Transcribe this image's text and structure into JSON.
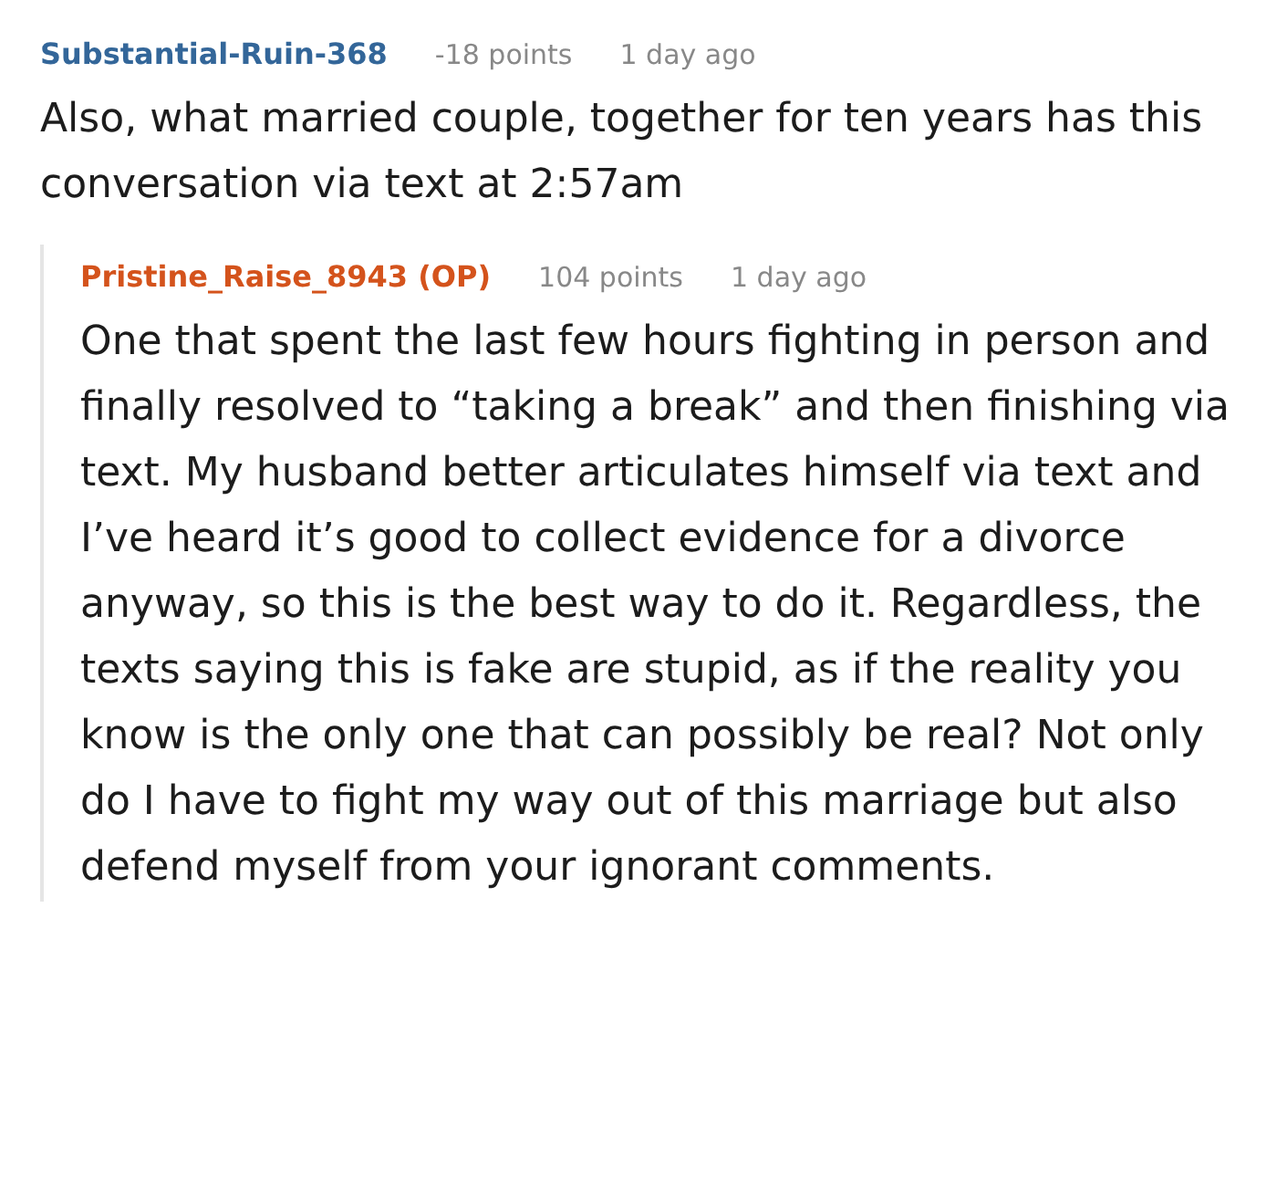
{
  "comments": [
    {
      "author": "Substantial-Ruin-368",
      "op": false,
      "points": "-18 points",
      "time": "1 day ago",
      "body": "Also, what married couple, together for ten years has this conversation via text at 2:57am",
      "replies": [
        {
          "author": "Pristine_Raise_8943 (OP)",
          "op": true,
          "points": "104 points",
          "time": "1 day ago",
          "body": "One that spent the last few hours fighting in person and finally resolved to “taking a break” and then finishing via text. My husband better articulates himself via text and I’ve heard it’s good to collect evidence for a divorce anyway, so this is the best way to do it. Regardless, the texts saying this is fake are stupid, as if the reality you know is the only one that can possibly be real? Not only do I have to fight my way out of this marriage but also defend myself from your ignorant comments."
        }
      ]
    }
  ]
}
